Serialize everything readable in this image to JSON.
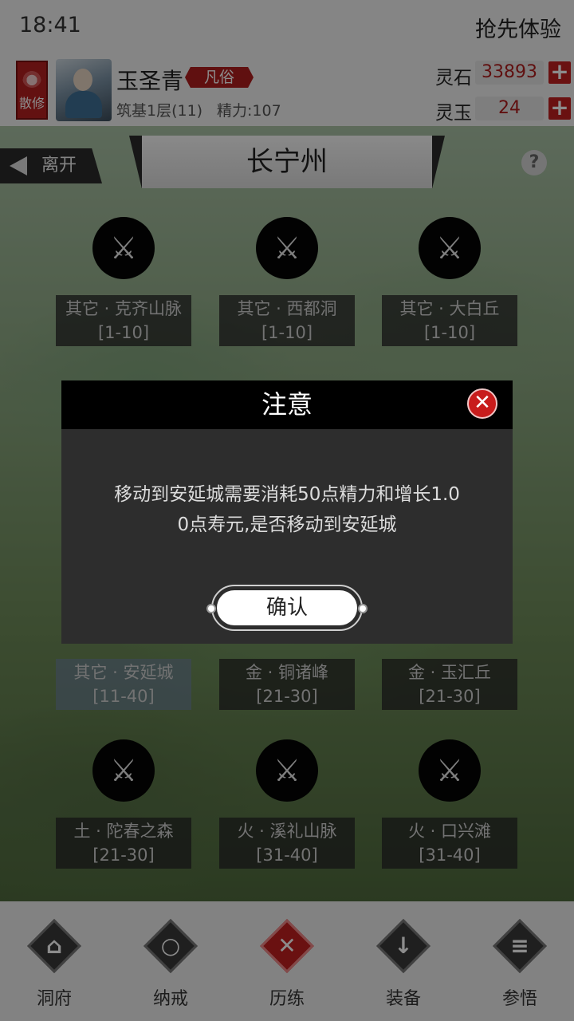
{
  "status_bar": {
    "time": "18:41",
    "promo": "抢先体验"
  },
  "player": {
    "sect": "散修",
    "name": "玉圣青",
    "rank": "凡俗",
    "realm": "筑基1层(11)",
    "stamina": "精力:107"
  },
  "currencies": [
    {
      "label": "灵石",
      "value": "33893",
      "add_icon": "plus-icon"
    },
    {
      "label": "灵玉",
      "value": "24",
      "add_icon": "plus-icon"
    }
  ],
  "map": {
    "leave_label": "离开",
    "title": "长宁州",
    "help_label": "?",
    "nodes": [
      {
        "name": "其它 · 克齐山脉",
        "range": "[1-10]",
        "icon": "crossed-swords-icon"
      },
      {
        "name": "其它 · 西都洞",
        "range": "[1-10]",
        "icon": "crossed-swords-icon"
      },
      {
        "name": "其它 · 大白丘",
        "range": "[1-10]",
        "icon": "crossed-swords-icon"
      },
      {
        "name": "其它 · 安延城",
        "range": "[11-40]"
      },
      {
        "name": "金 · 铜诸峰",
        "range": "[21-30]"
      },
      {
        "name": "金 · 玉汇丘",
        "range": "[21-30]"
      },
      {
        "name": "土 · 陀春之森",
        "range": "[21-30]",
        "icon": "crossed-swords-icon"
      },
      {
        "name": "火 · 溪礼山脉",
        "range": "[31-40]",
        "icon": "crossed-swords-icon"
      },
      {
        "name": "火 · 口兴滩",
        "range": "[31-40]",
        "icon": "crossed-swords-icon"
      }
    ]
  },
  "nav": [
    {
      "label": "洞府",
      "icon": "pavilion-icon"
    },
    {
      "label": "纳戒",
      "icon": "ring-icon"
    },
    {
      "label": "历练",
      "icon": "crossed-swords-icon",
      "active": true
    },
    {
      "label": "装备",
      "icon": "sword-icon"
    },
    {
      "label": "参悟",
      "icon": "book-icon"
    }
  ],
  "dialog": {
    "title": "注意",
    "message_line1": "移动到安延城需要消耗50点精力和增长1.0",
    "message_line2": "0点寿元,是否移动到安延城",
    "confirm_label": "确认",
    "close_icon": "close-icon"
  },
  "colors": {
    "accent": "#c21f1f",
    "dialog_bg": "#2d2d2d",
    "dialog_header": "#000000"
  }
}
